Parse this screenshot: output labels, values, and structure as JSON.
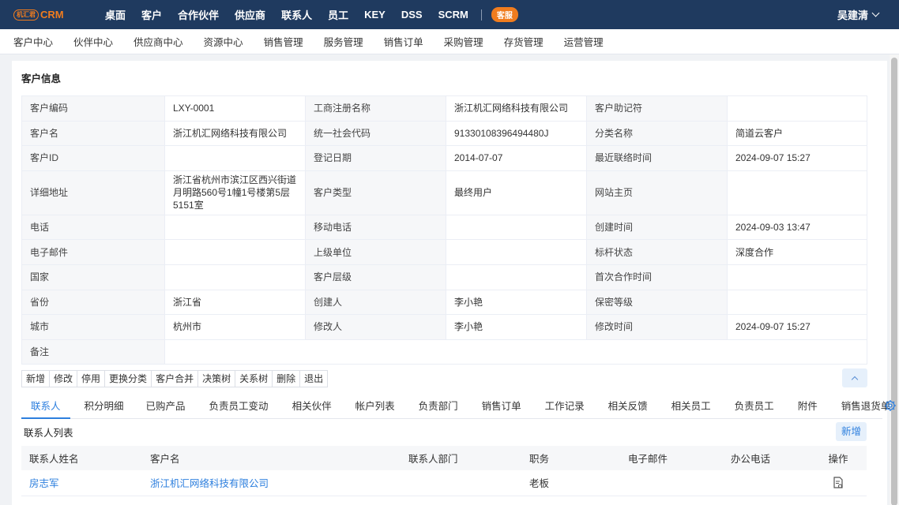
{
  "topbar": {
    "logo_badge": "机汇君",
    "logo_text": "CRM",
    "nav": [
      "桌面",
      "客户",
      "合作伙伴",
      "供应商",
      "联系人",
      "员工",
      "KEY",
      "DSS",
      "SCRM"
    ],
    "kefu": "客服",
    "user": "吴建清"
  },
  "subnav": [
    "客户中心",
    "伙伴中心",
    "供应商中心",
    "资源中心",
    "销售管理",
    "服务管理",
    "销售订单",
    "采购管理",
    "存货管理",
    "运营管理"
  ],
  "section_title": "客户信息",
  "info": {
    "customer_code_label": "客户编码",
    "customer_code": "LXY-0001",
    "reg_name_label": "工商注册名称",
    "reg_name": "浙江机汇网络科技有限公司",
    "mnemonic_label": "客户助记符",
    "mnemonic": "",
    "customer_name_label": "客户名",
    "customer_name": "浙江机汇网络科技有限公司",
    "credit_code_label": "统一社会代码",
    "credit_code": "91330108396494480J",
    "category_label": "分类名称",
    "category": "简道云客户",
    "customer_id_label": "客户ID",
    "customer_id": "",
    "reg_date_label": "登记日期",
    "reg_date": "2014-07-07",
    "last_contact_label": "最近联络时间",
    "last_contact": "2024-09-07 15:27",
    "address_label": "详细地址",
    "address": "浙江省杭州市滨江区西兴街道月明路560号1幢1号楼第5层5151室",
    "customer_type_label": "客户类型",
    "customer_type": "最终用户",
    "website_label": "网站主页",
    "website": "",
    "phone_label": "电话",
    "phone": "",
    "mobile_label": "移动电话",
    "mobile": "",
    "created_time_label": "创建时间",
    "created_time": "2024-09-03 13:47",
    "email_label": "电子邮件",
    "email": "",
    "parent_label": "上级单位",
    "parent": "",
    "benchmark_label": "标杆状态",
    "benchmark": "深度合作",
    "country_label": "国家",
    "country": "",
    "level_label": "客户层级",
    "level": "",
    "first_coop_label": "首次合作时间",
    "first_coop": "",
    "province_label": "省份",
    "province": "浙江省",
    "creator_label": "创建人",
    "creator": "李小艳",
    "secrecy_label": "保密等级",
    "secrecy": "",
    "city_label": "城市",
    "city": "杭州市",
    "modifier_label": "修改人",
    "modifier": "李小艳",
    "modified_time_label": "修改时间",
    "modified_time": "2024-09-07 15:27",
    "remark_label": "备注",
    "remark": ""
  },
  "actions": [
    "新增",
    "修改",
    "停用",
    "更换分类",
    "客户合并",
    "决策树",
    "关系树",
    "删除",
    "退出"
  ],
  "tabs": [
    "联系人",
    "积分明细",
    "已购产品",
    "负责员工变动",
    "相关伙伴",
    "帐户列表",
    "负责部门",
    "销售订单",
    "工作记录",
    "相关反馈",
    "相关员工",
    "负责员工",
    "附件",
    "销售退货单"
  ],
  "contacts": {
    "title": "联系人列表",
    "add_label": "新增",
    "headers": [
      "联系人姓名",
      "客户名",
      "联系人部门",
      "职务",
      "电子邮件",
      "办公电话",
      "操作"
    ],
    "rows": [
      {
        "name": "房志军",
        "customer": "浙江机汇网络科技有限公司",
        "dept": "",
        "title": "老板",
        "email": "",
        "phone": ""
      }
    ]
  }
}
